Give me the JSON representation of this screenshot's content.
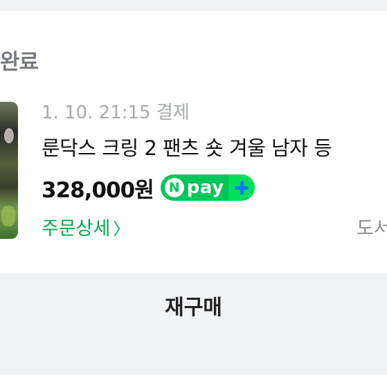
{
  "order": {
    "status_title": "완료",
    "time": "1. 10. 21:15 결제",
    "product_name": "룬닥스 크링 2 팬츠 숏 겨울 남자 등",
    "price": "328,000원",
    "npay": {
      "n": "N",
      "label": "pay"
    },
    "detail_link": "주문상세",
    "detail_chevron": "〉",
    "delivery_status": "도서"
  },
  "actions": {
    "rebuy_label": "재구매"
  },
  "colors": {
    "naver_green": "#03c75a",
    "link_green": "#03a94f",
    "plus_blue": "#0b78ff"
  }
}
